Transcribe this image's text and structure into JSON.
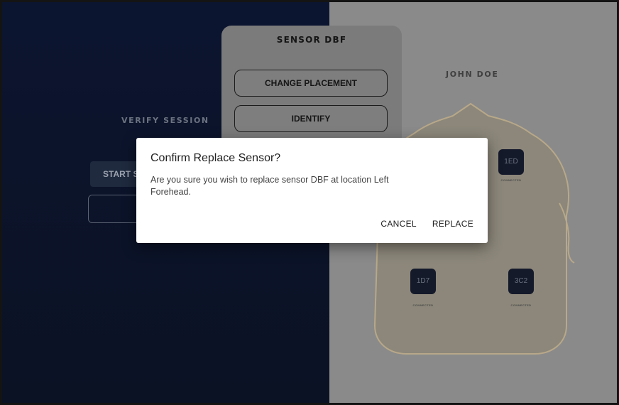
{
  "verify_session": {
    "title": "VERIFY SESSION",
    "start_button_label": "START S"
  },
  "sensor_menu": {
    "title": "SENSOR DBF",
    "change_placement_label": "CHANGE PLACEMENT",
    "identify_label": "IDENTIFY"
  },
  "patient": {
    "name": "JOHN DOE"
  },
  "sensors": [
    {
      "id": "1ED",
      "status": "CONNECTED"
    },
    {
      "id": "1D7",
      "status": "CONNECTED"
    },
    {
      "id": "3C2",
      "status": "CONNECTED"
    }
  ],
  "dialog": {
    "title": "Confirm Replace Sensor?",
    "message": "Are you sure you wish to replace sensor DBF at location Left Forehead.",
    "cancel_label": "CANCEL",
    "replace_label": "REPLACE"
  },
  "colors": {
    "left_panel_bg": "#0c1530",
    "right_panel_bg": "#8a8a8a",
    "sensor_bg": "#151a2b",
    "head_outline": "#b8a889"
  }
}
